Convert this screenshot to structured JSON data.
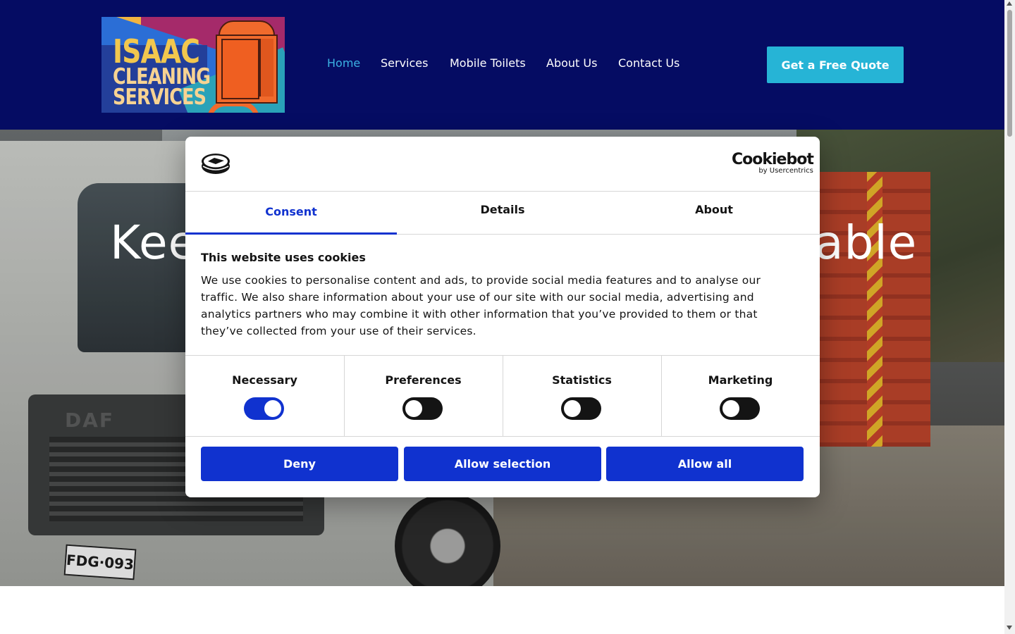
{
  "header": {
    "logo": {
      "line1": "ISAAC",
      "line2": "CLEANING",
      "line3": "SERVICES"
    },
    "nav": [
      {
        "label": "Home",
        "active": true
      },
      {
        "label": "Services",
        "active": false
      },
      {
        "label": "Mobile Toilets",
        "active": false
      },
      {
        "label": "About Us",
        "active": false
      },
      {
        "label": "Contact Us",
        "active": false
      }
    ],
    "cta_label": "Get a Free Quote"
  },
  "hero": {
    "title_start": "Kee",
    "title_end": "able",
    "truck_brand": "DAF",
    "plate": "FDG·093"
  },
  "cookie_dialog": {
    "brand_name": "Cookiebot",
    "brand_sub": "by Usercentrics",
    "tabs": [
      "Consent",
      "Details",
      "About"
    ],
    "active_tab": "Consent",
    "title": "This website uses cookies",
    "body": "We use cookies to personalise content and ads, to provide social media features and to analyse our traffic. We also share information about your use of our site with our social media, advertising and analytics partners who may combine it with other information that you’ve provided to them or that they’ve collected from your use of their services.",
    "categories": [
      {
        "label": "Necessary",
        "enabled": true
      },
      {
        "label": "Preferences",
        "enabled": false
      },
      {
        "label": "Statistics",
        "enabled": false
      },
      {
        "label": "Marketing",
        "enabled": false
      }
    ],
    "buttons": {
      "deny": "Deny",
      "allow_selection": "Allow selection",
      "allow_all": "Allow all"
    }
  },
  "colors": {
    "header_bg": "#050c63",
    "nav_active": "#3bb2e3",
    "cta_bg": "#26b4d6",
    "dialog_accent": "#1032cf"
  }
}
